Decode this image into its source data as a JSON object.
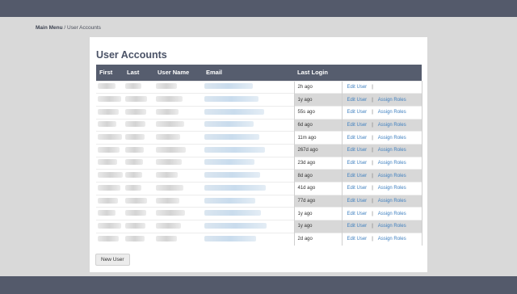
{
  "breadcrumb": {
    "root": "Main Menu",
    "separator": " / ",
    "current": "User Accounts"
  },
  "page": {
    "title": "User Accounts"
  },
  "table": {
    "headers": [
      "First",
      "Last",
      "User Name",
      "Email",
      "Last Login",
      ""
    ],
    "rows": [
      {
        "last_login": "2h ago",
        "edit": "Edit User",
        "sep": "|",
        "assign": ""
      },
      {
        "last_login": "1y ago",
        "edit": "Edit User",
        "sep": "|",
        "assign": "Assign Roles"
      },
      {
        "last_login": "55s ago",
        "edit": "Edit User",
        "sep": "|",
        "assign": "Assign Roles"
      },
      {
        "last_login": "6d ago",
        "edit": "Edit User",
        "sep": "|",
        "assign": "Assign Roles"
      },
      {
        "last_login": "11m ago",
        "edit": "Edit User",
        "sep": "|",
        "assign": "Assign Roles"
      },
      {
        "last_login": "267d ago",
        "edit": "Edit User",
        "sep": "|",
        "assign": "Assign Roles"
      },
      {
        "last_login": "23d ago",
        "edit": "Edit User",
        "sep": "|",
        "assign": "Assign Roles"
      },
      {
        "last_login": "8d ago",
        "edit": "Edit User",
        "sep": "|",
        "assign": "Assign Roles"
      },
      {
        "last_login": "41d ago",
        "edit": "Edit User",
        "sep": "|",
        "assign": "Assign Roles"
      },
      {
        "last_login": "77d ago",
        "edit": "Edit User",
        "sep": "|",
        "assign": "Assign Roles"
      },
      {
        "last_login": "1y ago",
        "edit": "Edit User",
        "sep": "|",
        "assign": "Assign Roles"
      },
      {
        "last_login": "1y ago",
        "edit": "Edit User",
        "sep": "|",
        "assign": "Assign Roles"
      },
      {
        "last_login": "2d ago",
        "edit": "Edit User",
        "sep": "|",
        "assign": "Assign Roles"
      }
    ]
  },
  "actions": {
    "new_user": "New User"
  },
  "colors": {
    "bar": "#545a6b",
    "header": "#565d6e",
    "link": "#3e7fbf",
    "background": "#d9d9d9"
  }
}
